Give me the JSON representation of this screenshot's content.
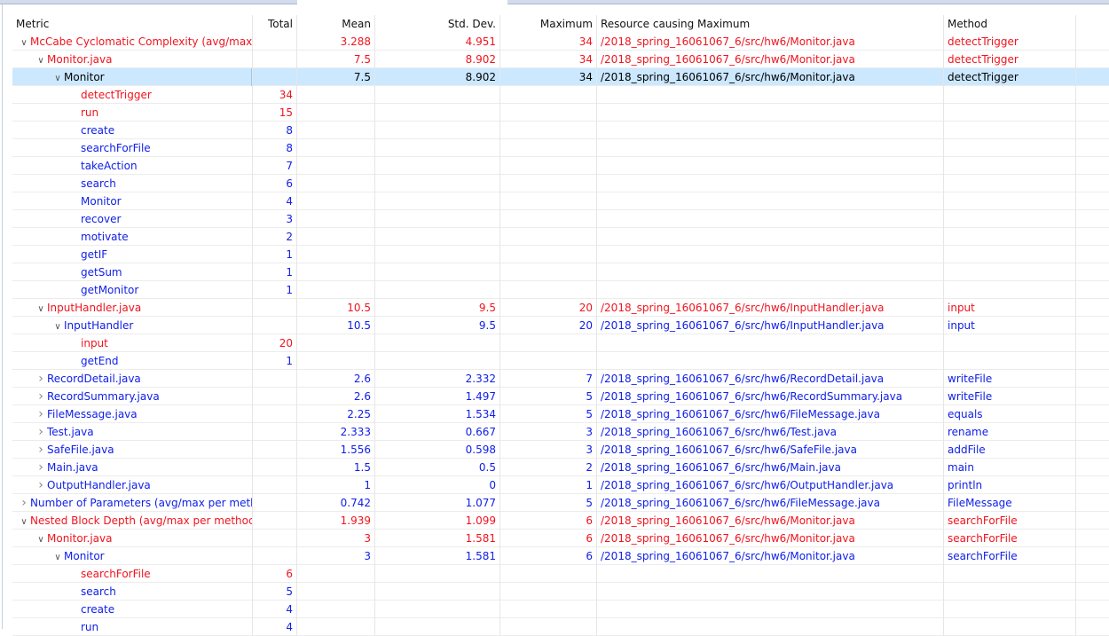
{
  "columns": {
    "metric": "Metric",
    "total": "Total",
    "mean": "Mean",
    "std": "Std. Dev.",
    "max": "Maximum",
    "resource": "Resource causing Maximum",
    "method": "Method"
  },
  "rows": [
    {
      "level": 0,
      "toggle": "open",
      "color": "red",
      "name": "McCabe Cyclomatic Complexity (avg/max",
      "total": "",
      "mean": "3.288",
      "std": "4.951",
      "max": "34",
      "resource": "/2018_spring_16061067_6/src/hw6/Monitor.java",
      "method": "detectTrigger"
    },
    {
      "level": 1,
      "toggle": "open",
      "color": "red",
      "name": "Monitor.java",
      "total": "",
      "mean": "7.5",
      "std": "8.902",
      "max": "34",
      "resource": "/2018_spring_16061067_6/src/hw6/Monitor.java",
      "method": "detectTrigger"
    },
    {
      "level": 2,
      "toggle": "open",
      "color": "blue",
      "selected": true,
      "name": "Monitor",
      "total": "",
      "mean": "7.5",
      "std": "8.902",
      "max": "34",
      "resource": "/2018_spring_16061067_6/src/hw6/Monitor.java",
      "method": "detectTrigger"
    },
    {
      "level": 3,
      "color": "red",
      "name": "detectTrigger",
      "total": "34"
    },
    {
      "level": 3,
      "color": "red",
      "name": "run",
      "total": "15"
    },
    {
      "level": 3,
      "color": "blue",
      "name": "create",
      "total": "8"
    },
    {
      "level": 3,
      "color": "blue",
      "name": "searchForFile",
      "total": "8"
    },
    {
      "level": 3,
      "color": "blue",
      "name": "takeAction",
      "total": "7"
    },
    {
      "level": 3,
      "color": "blue",
      "name": "search",
      "total": "6"
    },
    {
      "level": 3,
      "color": "blue",
      "name": "Monitor",
      "total": "4"
    },
    {
      "level": 3,
      "color": "blue",
      "name": "recover",
      "total": "3"
    },
    {
      "level": 3,
      "color": "blue",
      "name": "motivate",
      "total": "2"
    },
    {
      "level": 3,
      "color": "blue",
      "name": "getIF",
      "total": "1"
    },
    {
      "level": 3,
      "color": "blue",
      "name": "getSum",
      "total": "1"
    },
    {
      "level": 3,
      "color": "blue",
      "name": "getMonitor",
      "total": "1"
    },
    {
      "level": 1,
      "toggle": "open",
      "color": "red",
      "name": "InputHandler.java",
      "total": "",
      "mean": "10.5",
      "std": "9.5",
      "max": "20",
      "resource": "/2018_spring_16061067_6/src/hw6/InputHandler.java",
      "method": "input"
    },
    {
      "level": 2,
      "toggle": "open",
      "color": "blue",
      "name": "InputHandler",
      "total": "",
      "mean": "10.5",
      "std": "9.5",
      "max": "20",
      "resource": "/2018_spring_16061067_6/src/hw6/InputHandler.java",
      "method": "input"
    },
    {
      "level": 3,
      "color": "red",
      "name": "input",
      "total": "20"
    },
    {
      "level": 3,
      "color": "blue",
      "name": "getEnd",
      "total": "1"
    },
    {
      "level": 1,
      "toggle": "closed",
      "color": "blue",
      "name": "RecordDetail.java",
      "total": "",
      "mean": "2.6",
      "std": "2.332",
      "max": "7",
      "resource": "/2018_spring_16061067_6/src/hw6/RecordDetail.java",
      "method": "writeFile"
    },
    {
      "level": 1,
      "toggle": "closed",
      "color": "blue",
      "name": "RecordSummary.java",
      "total": "",
      "mean": "2.6",
      "std": "1.497",
      "max": "5",
      "resource": "/2018_spring_16061067_6/src/hw6/RecordSummary.java",
      "method": "writeFile"
    },
    {
      "level": 1,
      "toggle": "closed",
      "color": "blue",
      "name": "FileMessage.java",
      "total": "",
      "mean": "2.25",
      "std": "1.534",
      "max": "5",
      "resource": "/2018_spring_16061067_6/src/hw6/FileMessage.java",
      "method": "equals"
    },
    {
      "level": 1,
      "toggle": "closed",
      "color": "blue",
      "name": "Test.java",
      "total": "",
      "mean": "2.333",
      "std": "0.667",
      "max": "3",
      "resource": "/2018_spring_16061067_6/src/hw6/Test.java",
      "method": "rename"
    },
    {
      "level": 1,
      "toggle": "closed",
      "color": "blue",
      "name": "SafeFile.java",
      "total": "",
      "mean": "1.556",
      "std": "0.598",
      "max": "3",
      "resource": "/2018_spring_16061067_6/src/hw6/SafeFile.java",
      "method": "addFile"
    },
    {
      "level": 1,
      "toggle": "closed",
      "color": "blue",
      "name": "Main.java",
      "total": "",
      "mean": "1.5",
      "std": "0.5",
      "max": "2",
      "resource": "/2018_spring_16061067_6/src/hw6/Main.java",
      "method": "main"
    },
    {
      "level": 1,
      "toggle": "closed",
      "color": "blue",
      "name": "OutputHandler.java",
      "total": "",
      "mean": "1",
      "std": "0",
      "max": "1",
      "resource": "/2018_spring_16061067_6/src/hw6/OutputHandler.java",
      "method": "println"
    },
    {
      "level": 0,
      "toggle": "closed",
      "color": "blue",
      "name": "Number of Parameters (avg/max per meth",
      "total": "",
      "mean": "0.742",
      "std": "1.077",
      "max": "5",
      "resource": "/2018_spring_16061067_6/src/hw6/FileMessage.java",
      "method": "FileMessage"
    },
    {
      "level": 0,
      "toggle": "open",
      "color": "red",
      "name": "Nested Block Depth (avg/max per methoc",
      "total": "",
      "mean": "1.939",
      "std": "1.099",
      "max": "6",
      "resource": "/2018_spring_16061067_6/src/hw6/Monitor.java",
      "method": "searchForFile"
    },
    {
      "level": 1,
      "toggle": "open",
      "color": "red",
      "name": "Monitor.java",
      "total": "",
      "mean": "3",
      "std": "1.581",
      "max": "6",
      "resource": "/2018_spring_16061067_6/src/hw6/Monitor.java",
      "method": "searchForFile"
    },
    {
      "level": 2,
      "toggle": "open",
      "color": "blue",
      "name": "Monitor",
      "total": "",
      "mean": "3",
      "std": "1.581",
      "max": "6",
      "resource": "/2018_spring_16061067_6/src/hw6/Monitor.java",
      "method": "searchForFile"
    },
    {
      "level": 3,
      "color": "red",
      "name": "searchForFile",
      "total": "6"
    },
    {
      "level": 3,
      "color": "blue",
      "name": "search",
      "total": "5"
    },
    {
      "level": 3,
      "color": "blue",
      "name": "create",
      "total": "4"
    },
    {
      "level": 3,
      "color": "blue",
      "name": "run",
      "total": "4"
    }
  ]
}
